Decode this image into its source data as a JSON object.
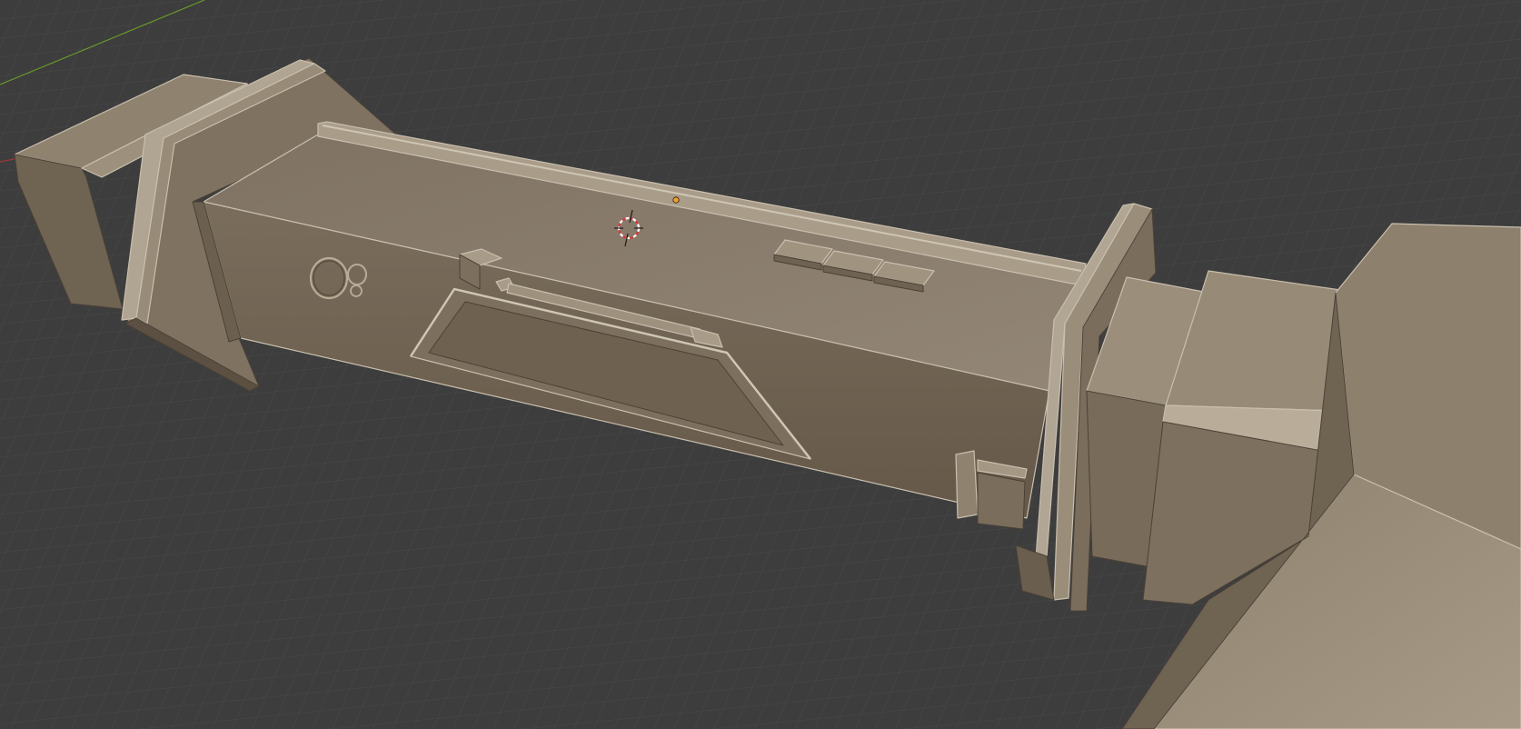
{
  "app": "3D viewport",
  "viewport": {
    "background_color": "#3d3d3d",
    "grid_color": "#4a4a4a",
    "x_axis_color": "#9a3a3a",
    "y_axis_color": "#6a9a2a",
    "model_base_color": "#8b7e6c",
    "model_highlight_color": "#bdb2a0",
    "model_shadow_color": "#5e5244",
    "cursor_colors": [
      "#d83a3a",
      "#ffffff"
    ],
    "origin_color": "#f0a030"
  },
  "objects": [
    {
      "name": "main-housing",
      "type": "mesh"
    },
    {
      "name": "pipe-rail",
      "type": "mesh"
    },
    {
      "name": "left-collar",
      "type": "mesh"
    },
    {
      "name": "right-collar",
      "type": "mesh"
    },
    {
      "name": "trapezoid-panel",
      "type": "mesh"
    },
    {
      "name": "button-row",
      "type": "mesh"
    },
    {
      "name": "end-blocks",
      "type": "mesh"
    }
  ],
  "icons": {
    "cursor": "3d-cursor-icon",
    "origin": "origin-dot-icon"
  }
}
